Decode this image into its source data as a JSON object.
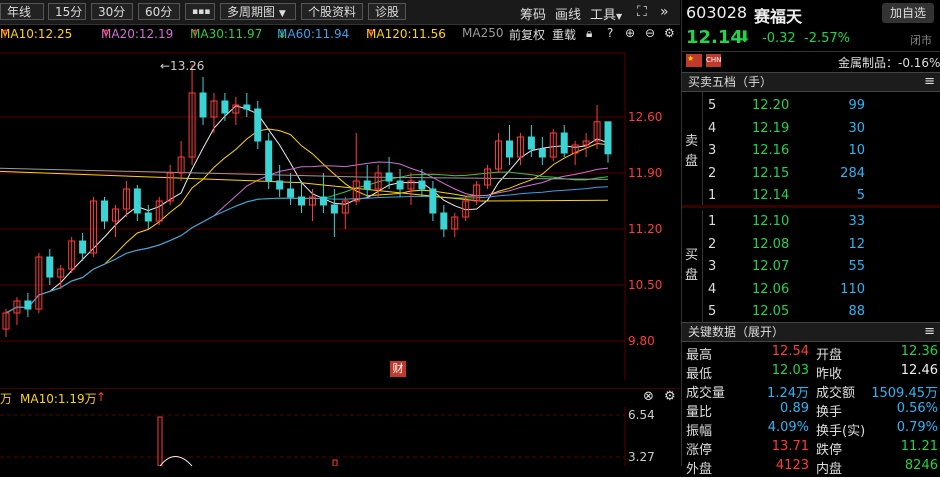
{
  "toolbar": {
    "period_buttons": [
      "年线",
      "15分",
      "30分",
      "60分",
      "▪▪▪"
    ],
    "multi_period": "多周期图",
    "stock_info": "个股资料",
    "diagnose": "诊股",
    "chip": "筹码",
    "draw_line": "画线",
    "tools": "工具"
  },
  "ma_legend": {
    "items": [
      {
        "label": "MA10:12.25",
        "arrow": "↑",
        "color": "#ffd400"
      },
      {
        "label": "MA20:12.19",
        "arrow": "↑",
        "color": "#d46cd8"
      },
      {
        "label": "MA30:11.97",
        "arrow": "↑",
        "color": "#2ecc40"
      },
      {
        "label": "MA60:11.94",
        "arrow": "↓",
        "color": "#3aa0e8"
      },
      {
        "label": "MA120:11.56",
        "arrow": "↑",
        "color": "#ffd400"
      },
      {
        "label": "MA250",
        "arrow": "",
        "color": "#9a9a9a"
      }
    ],
    "adjust": "前复权",
    "overlay": "重载"
  },
  "chart_data": {
    "type": "candlestick",
    "y_ticks": [
      "12.60",
      "11.90",
      "11.20",
      "10.50",
      "9.80"
    ],
    "high_marker": "←13.26",
    "finance_badge": "财",
    "candles": [
      [
        9.95,
        10.2,
        9.85,
        10.15
      ],
      [
        10.15,
        10.35,
        10.0,
        10.3
      ],
      [
        10.3,
        10.4,
        10.1,
        10.2
      ],
      [
        10.2,
        10.9,
        10.15,
        10.85
      ],
      [
        10.85,
        10.95,
        10.5,
        10.6
      ],
      [
        10.6,
        10.75,
        10.45,
        10.7
      ],
      [
        10.7,
        11.1,
        10.65,
        11.05
      ],
      [
        11.05,
        11.15,
        10.8,
        10.9
      ],
      [
        10.9,
        11.6,
        10.85,
        11.55
      ],
      [
        11.55,
        11.6,
        11.2,
        11.3
      ],
      [
        11.3,
        11.5,
        11.1,
        11.45
      ],
      [
        11.45,
        11.8,
        11.35,
        11.7
      ],
      [
        11.7,
        11.75,
        11.3,
        11.4
      ],
      [
        11.4,
        11.5,
        11.2,
        11.3
      ],
      [
        11.3,
        11.6,
        11.25,
        11.55
      ],
      [
        11.55,
        12.0,
        11.5,
        11.9
      ],
      [
        11.9,
        12.3,
        11.8,
        12.1
      ],
      [
        12.1,
        13.26,
        12.0,
        12.9
      ],
      [
        12.9,
        13.1,
        12.5,
        12.6
      ],
      [
        12.6,
        12.9,
        12.4,
        12.8
      ],
      [
        12.8,
        12.9,
        12.55,
        12.65
      ],
      [
        12.65,
        12.85,
        12.5,
        12.75
      ],
      [
        12.75,
        12.9,
        12.6,
        12.7
      ],
      [
        12.7,
        12.8,
        12.2,
        12.3
      ],
      [
        12.3,
        12.4,
        11.7,
        11.8
      ],
      [
        11.8,
        12.0,
        11.6,
        11.7
      ],
      [
        11.7,
        11.9,
        11.5,
        11.6
      ],
      [
        11.6,
        11.8,
        11.4,
        11.5
      ],
      [
        11.5,
        11.7,
        11.3,
        11.6
      ],
      [
        11.6,
        11.9,
        11.4,
        11.5
      ],
      [
        11.5,
        11.7,
        11.1,
        11.4
      ],
      [
        11.4,
        11.6,
        11.2,
        11.55
      ],
      [
        11.55,
        12.4,
        11.5,
        11.8
      ],
      [
        11.8,
        12.0,
        11.6,
        11.7
      ],
      [
        11.7,
        12.0,
        11.6,
        11.9
      ],
      [
        11.9,
        12.1,
        11.7,
        11.8
      ],
      [
        11.8,
        11.95,
        11.6,
        11.7
      ],
      [
        11.7,
        11.9,
        11.5,
        11.8
      ],
      [
        11.8,
        11.95,
        11.6,
        11.7
      ],
      [
        11.7,
        11.8,
        11.3,
        11.4
      ],
      [
        11.4,
        11.5,
        11.1,
        11.2
      ],
      [
        11.2,
        11.4,
        11.1,
        11.35
      ],
      [
        11.35,
        11.6,
        11.3,
        11.55
      ],
      [
        11.55,
        11.8,
        11.5,
        11.75
      ],
      [
        11.75,
        12.0,
        11.7,
        11.95
      ],
      [
        11.95,
        12.4,
        11.9,
        12.3
      ],
      [
        12.3,
        12.5,
        12.0,
        12.1
      ],
      [
        12.1,
        12.4,
        12.0,
        12.35
      ],
      [
        12.35,
        12.5,
        12.1,
        12.2
      ],
      [
        12.2,
        12.35,
        12.0,
        12.1
      ],
      [
        12.1,
        12.45,
        12.05,
        12.4
      ],
      [
        12.4,
        12.5,
        12.1,
        12.15
      ],
      [
        12.15,
        12.3,
        12.0,
        12.25
      ],
      [
        12.25,
        12.4,
        12.1,
        12.3
      ],
      [
        12.3,
        12.75,
        12.2,
        12.54
      ],
      [
        12.54,
        12.54,
        12.03,
        12.14
      ]
    ]
  },
  "volume": {
    "legend": "万",
    "ma10": "MA10:1.19万",
    "ticks": [
      "6.54",
      "3.27"
    ]
  },
  "quote": {
    "code": "603028",
    "name": "赛福天",
    "add_favorite": "加自选",
    "price": "12.14",
    "change": "-0.32",
    "change_pct": "-2.57%",
    "status": "闭市",
    "flag_text": "CHN",
    "sector": "金属制品：-0.16%"
  },
  "order_book": {
    "title": "买卖五档（手）",
    "sell_label": "卖\n盘",
    "buy_label": "买\n盘",
    "sells": [
      {
        "level": "5",
        "price": "12.20",
        "volume": "99"
      },
      {
        "level": "4",
        "price": "12.19",
        "volume": "30"
      },
      {
        "level": "3",
        "price": "12.16",
        "volume": "10"
      },
      {
        "level": "2",
        "price": "12.15",
        "volume": "284"
      },
      {
        "level": "1",
        "price": "12.14",
        "volume": "5"
      }
    ],
    "buys": [
      {
        "level": "1",
        "price": "12.10",
        "volume": "33"
      },
      {
        "level": "2",
        "price": "12.08",
        "volume": "12"
      },
      {
        "level": "3",
        "price": "12.07",
        "volume": "55"
      },
      {
        "level": "4",
        "price": "12.06",
        "volume": "110"
      },
      {
        "level": "5",
        "price": "12.05",
        "volume": "88"
      }
    ]
  },
  "key_data": {
    "title": "关键数据（展开）",
    "rows": [
      {
        "l1": "最高",
        "v1": "12.54",
        "c1": "red",
        "l2": "开盘",
        "v2": "12.36",
        "c2": "green"
      },
      {
        "l1": "最低",
        "v1": "12.03",
        "c1": "green",
        "l2": "昨收",
        "v2": "12.46",
        "c2": "white"
      },
      {
        "l1": "成交量",
        "v1": "1.24万",
        "c1": "cyan",
        "l2": "成交额",
        "v2": "1509.45万",
        "c2": "cyan"
      },
      {
        "l1": "量比",
        "v1": "0.89",
        "c1": "cyan",
        "l2": "换手",
        "v2": "0.56%",
        "c2": "cyan"
      },
      {
        "l1": "振幅",
        "v1": "4.09%",
        "c1": "cyan",
        "l2": "换手(实)",
        "v2": "0.79%",
        "c2": "cyan"
      },
      {
        "l1": "涨停",
        "v1": "13.71",
        "c1": "red",
        "l2": "跌停",
        "v2": "11.21",
        "c2": "green"
      },
      {
        "l1": "外盘",
        "v1": "4123",
        "c1": "red",
        "l2": "内盘",
        "v2": "8246",
        "c2": "green"
      }
    ]
  }
}
